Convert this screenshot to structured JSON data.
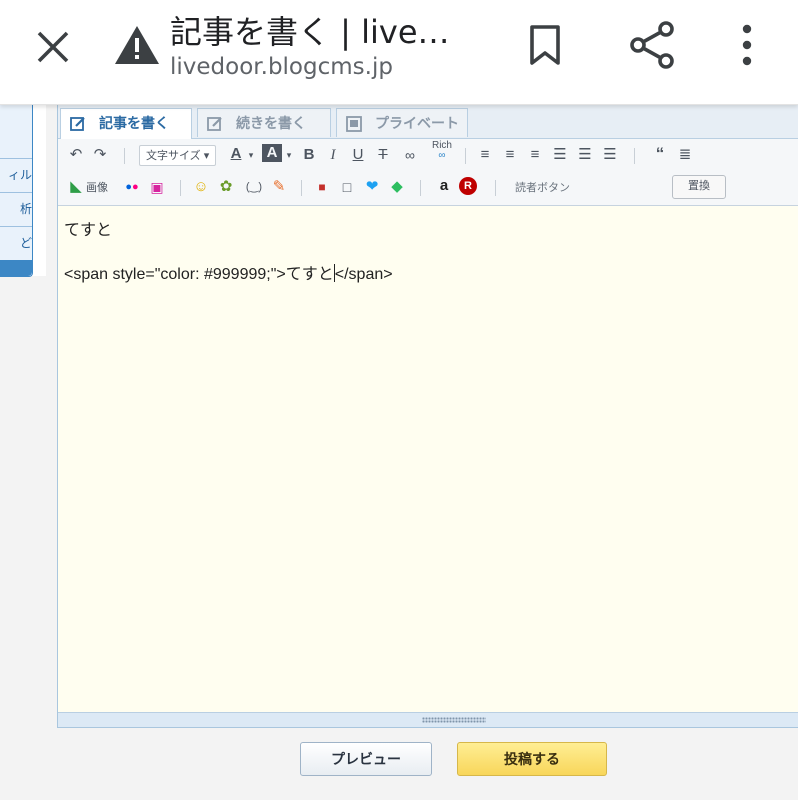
{
  "browser": {
    "title": "記事を書く | live…",
    "url": "livedoor.blogcms.jp"
  },
  "sidebar": {
    "items": [
      {
        "label": ""
      },
      {
        "label": "ィル"
      },
      {
        "label": "析"
      },
      {
        "label": "ど"
      }
    ]
  },
  "editor": {
    "tabs": [
      {
        "label": "記事を書く",
        "active": true
      },
      {
        "label": "続きを書く",
        "active": false
      },
      {
        "label": "プライベート",
        "active": false
      }
    ],
    "toolbar": {
      "font_size_label": "文字サイズ",
      "rich_label": "Rich",
      "image_label": "画像",
      "reader_button_label": "読者ボタン",
      "replace_label": "置換"
    },
    "content": {
      "line1": "てすと",
      "line2_before_caret": "<span style=\"color: #999999;\">てすと",
      "line2_after_caret": "</span>"
    }
  },
  "actions": {
    "preview_label": "プレビュー",
    "post_label": "投稿する"
  },
  "colors": {
    "editor_background": "#fffef0",
    "accent_blue": "#3c87c5",
    "post_button": "#f8d65a"
  }
}
